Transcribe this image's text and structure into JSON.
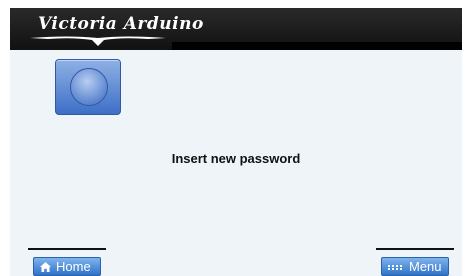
{
  "header": {
    "logo_text": "Victoria Arduino"
  },
  "main": {
    "lock_icon": "lock-icon",
    "prompt": "Insert new password"
  },
  "footer": {
    "home_label": "Home",
    "home_icon": "home-icon",
    "menu_label": "Menu",
    "menu_icon": "menu-dots-icon"
  },
  "colors": {
    "header_bg": "#1a1a1a",
    "screen_bg": "#eef4f7",
    "button_blue": "#2f73c9"
  }
}
